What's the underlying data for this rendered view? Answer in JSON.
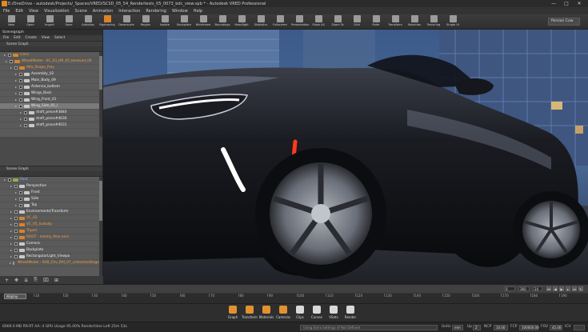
{
  "titlebar": {
    "title": "E:/OneDrive - autodesk/Projects/_Spaces/VRED/SCSD_05_54_Rendertests_05_0073_bdc_view.vpb * - Autodesk VRED Professional",
    "minimize": "—",
    "maximize": "□",
    "close": "✕"
  },
  "menu": [
    "File",
    "Edit",
    "View",
    "Visualization",
    "Scene",
    "Animation",
    "Interaction",
    "Rendering",
    "Window",
    "Help"
  ],
  "toolbar": {
    "items": [
      {
        "label": "New",
        "icon": "new-file-icon"
      },
      {
        "label": "Open",
        "icon": "open-folder-icon"
      },
      {
        "label": "Import",
        "icon": "import-icon"
      },
      {
        "label": "Save",
        "icon": "save-icon"
      },
      {
        "label": "Antialias",
        "icon": "antialias-icon"
      },
      {
        "label": "Raytracing",
        "icon": "raytracing-icon"
      },
      {
        "label": "Downscale",
        "icon": "downscale-icon"
      },
      {
        "label": "Region",
        "icon": "region-icon"
      },
      {
        "label": "Isolate",
        "icon": "isolate-icon"
      },
      {
        "label": "Backplate",
        "icon": "backplate-icon"
      },
      {
        "label": "Wireframe",
        "icon": "wireframe-icon"
      },
      {
        "label": "Boundings",
        "icon": "boundings-icon"
      },
      {
        "label": "Headlight",
        "icon": "headlight-icon"
      },
      {
        "label": "Statistics",
        "icon": "statistics-icon"
      },
      {
        "label": "Fullscreen",
        "icon": "fullscreen-icon"
      },
      {
        "label": "Presentation",
        "icon": "presentation-icon"
      },
      {
        "label": "Show All",
        "icon": "show-all-icon"
      },
      {
        "label": "Zoom To",
        "icon": "zoom-to-icon"
      },
      {
        "label": "Grid",
        "icon": "grid-icon"
      },
      {
        "label": "Ruler",
        "icon": "ruler-icon"
      },
      {
        "label": "Transform",
        "icon": "transform-icon"
      },
      {
        "label": "Selection",
        "icon": "selection-icon"
      },
      {
        "label": "Texturing",
        "icon": "texturing-icon"
      },
      {
        "label": "Single UI",
        "icon": "single-ui-icon"
      }
    ],
    "camera_select": "Persian Cow"
  },
  "scenegraph": {
    "window_title": "Scenegraph",
    "menu": [
      "File",
      "Edit",
      "Create",
      "View",
      "Select"
    ],
    "top_section_label": "Scene Graph",
    "top_rows": [
      {
        "text": "Lines",
        "style": "o"
      },
      {
        "text": "WheelModel - SC_03_HR_05_baseLod_04",
        "style": "o"
      },
      {
        "text": "Alfa_Shape_Poly",
        "style": "o"
      },
      {
        "text": "Assembly_02",
        "style": "w"
      },
      {
        "text": "Main_Body_09",
        "style": "w"
      },
      {
        "text": "Antenna_bottom",
        "style": "w"
      },
      {
        "text": "Wings_Back",
        "style": "w"
      },
      {
        "text": "Wing_Front_01",
        "style": "w"
      },
      {
        "text": "Wing_Side_01_l",
        "style": "w"
      },
      {
        "text": "draft_piece#3840",
        "style": "w"
      },
      {
        "text": "draft_piece#4030",
        "style": "w"
      },
      {
        "text": "draft_piece#4031",
        "style": "w"
      }
    ],
    "bottom_section_label": "Scene Graph",
    "bottom_rows": [
      {
        "text": "Root",
        "style": "bl"
      },
      {
        "text": "Perspective",
        "style": "w"
      },
      {
        "text": "Front",
        "style": "w"
      },
      {
        "text": "Side",
        "style": "w"
      },
      {
        "text": "Top",
        "style": "w"
      },
      {
        "text": "Environments/Transform",
        "style": "w"
      },
      {
        "text": "VC_02",
        "style": "o"
      },
      {
        "text": "VC_05_Isaksdy",
        "style": "o"
      },
      {
        "text": "Tripod",
        "style": "o"
      },
      {
        "text": "ROOT - mainly_floor.ansi",
        "style": "o"
      },
      {
        "text": "Camera",
        "style": "w"
      },
      {
        "text": "Backplate",
        "style": "w"
      },
      {
        "text": "RectangularLight_Viewpo",
        "style": "w"
      },
      {
        "text": "WheelModel - SVB_Chv_Rfd_07_collectionStage_01",
        "style": "o"
      }
    ],
    "tools": [
      "+",
      "✥",
      "⇊",
      "⎘",
      "⌧",
      "⊞"
    ]
  },
  "timeline": {
    "start": "0",
    "end": "360",
    "fps": "24",
    "current_frame": "display",
    "ruler_ticks": [
      "10",
      "20",
      "30",
      "40",
      "50",
      "60",
      "70",
      "80",
      "90",
      "100",
      "110",
      "120",
      "130",
      "140",
      "150",
      "160",
      "170",
      "180",
      "190"
    ]
  },
  "dock": [
    {
      "label": "Graph",
      "icon": "graph-icon"
    },
    {
      "label": "Transform",
      "icon": "transform-icon"
    },
    {
      "label": "Materials",
      "icon": "materials-icon"
    },
    {
      "label": "Cameras",
      "icon": "cameras-icon"
    },
    {
      "label": "Clips",
      "icon": "clips-icon"
    },
    {
      "label": "Curves",
      "icon": "curves-icon"
    },
    {
      "label": "VSets",
      "icon": "vsets-icon"
    },
    {
      "label": "Render",
      "icon": "render-icon"
    }
  ],
  "status": {
    "memory": "6069.0 MB  ",
    "text": "RR-RT  AA: 4  GPU Usage 95.00%  Rendertime Left 25m 53s",
    "command_placeholder": "Using Extra Settings of Not Defined",
    "units_label": "Units",
    "units_value": "mm",
    "up_label": "Up",
    "up_value": "Z",
    "ncp_label": "NCP",
    "ncp_value": "10.00",
    "fcp_label": "FCP",
    "fcp_value": "100000.00",
    "fov_label": "FOV",
    "fov_value": "45.00",
    "ich_label": "ICV"
  },
  "colors": {
    "accent": "#d9832b",
    "window_bg": "#3a3a3a"
  }
}
